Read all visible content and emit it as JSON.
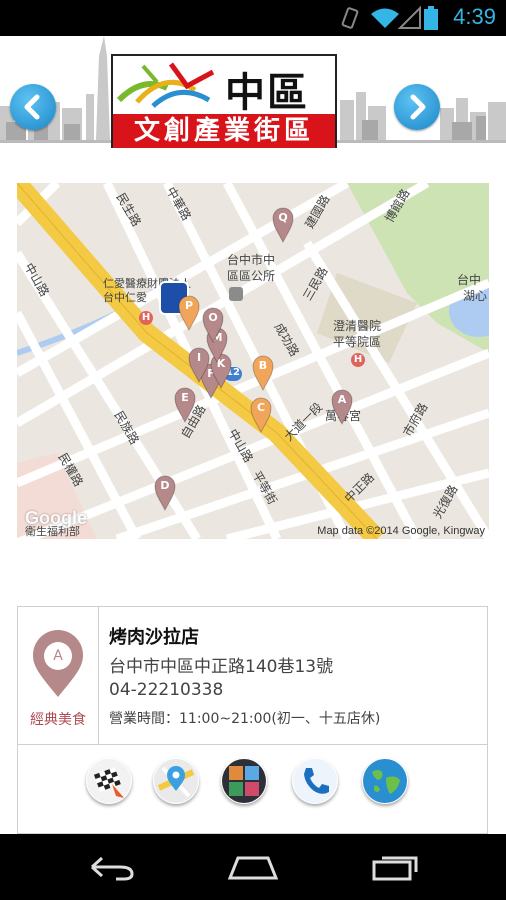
{
  "status_bar": {
    "time": "4:39"
  },
  "header": {
    "logo_title": "中區",
    "logo_subtitle": "文創產業街區"
  },
  "map": {
    "attribution": "Map data ©2014 Google, Kingway",
    "google_logo": "Google",
    "labels": {
      "l1": "台中市中",
      "l2": "區區公所",
      "l3": "仁愛醫療財團法人",
      "l4": "台中仁愛",
      "l5": "澄清醫院",
      "l6": "平等院區",
      "l7": "台中",
      "l8": "湖心",
      "l9": "萬春宮",
      "l10": "衛生福利部",
      "l11": "中正路",
      "l12": "大道一段",
      "l13": "民族路",
      "l14": "民權路",
      "l15": "中山路",
      "l16": "成功路",
      "l17": "三民路",
      "l18": "自由路",
      "l19": "中山路",
      "l20": "中華路",
      "l21": "平等街",
      "l22": "市府路",
      "l23": "光復路",
      "l24": "民生路",
      "l25": "建國路",
      "l26": "博館路"
    },
    "markers": [
      "A",
      "B",
      "C",
      "D",
      "E",
      "F",
      "I",
      "K",
      "M",
      "O",
      "P",
      "Q"
    ],
    "route_badge": "12"
  },
  "store": {
    "category_letter": "A",
    "category_label": "經典美食",
    "name": "烤肉沙拉店",
    "address": "台中市中區中正路140巷13號",
    "phone": "04-22210338",
    "hours": "營業時間：11:00~21:00(初一、十五店休)"
  },
  "colors": {
    "accent": "#1a86c8",
    "logo_red": "#d8141a",
    "pin": "#b5888a",
    "pin_orange": "#f0a55a"
  }
}
